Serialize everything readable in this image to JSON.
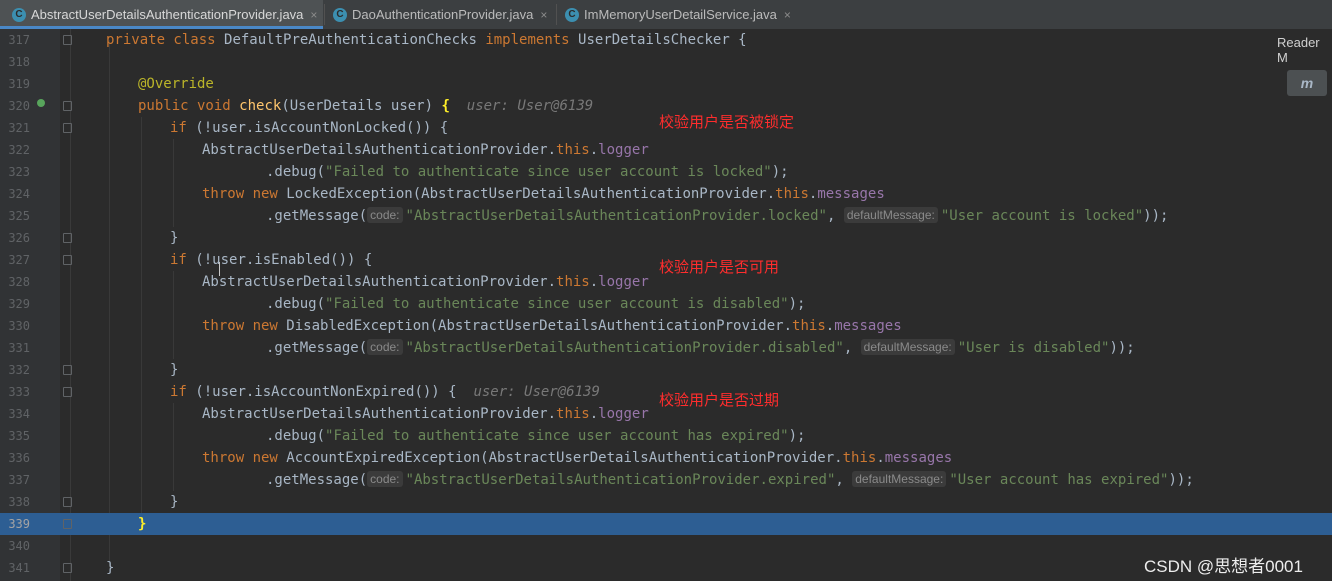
{
  "tabs": [
    {
      "label": "AbstractUserDetailsAuthenticationProvider.java",
      "icon": "java-class-icon"
    },
    {
      "label": "DaoAuthenticationProvider.java",
      "icon": "java-class-icon"
    },
    {
      "label": "ImMemoryUserDetailService.java",
      "icon": "java-class-icon"
    }
  ],
  "close_glyph": "×",
  "reader_mode_label": "Reader M",
  "maven_icon_label": "m",
  "notes": [
    "校验用户是否被锁定",
    "校验用户是否可用",
    "校验用户是否过期"
  ],
  "watermark": "CSDN @思想者0001",
  "code": {
    "l317_a": "private class ",
    "l317_b": "DefaultPreAuthenticationChecks ",
    "l317_c": "implements ",
    "l317_d": "UserDetailsChecker {",
    "l319": "@Override",
    "l320_a": "public void ",
    "l320_b": "check",
    "l320_c": "(UserDetails user) ",
    "l320_d": "{",
    "l320_hint": "user: User@6139",
    "l321_a": "if ",
    "l321_b": "(!user.isAccountNonLocked()) {",
    "l322_a": "AbstractUserDetailsAuthenticationProvider.",
    "l322_b": "this",
    "l322_c": ".",
    "l322_d": "logger",
    "l323_a": ".debug(",
    "l323_b": "\"Failed to authenticate since user account is locked\"",
    "l323_c": ");",
    "l324_a": "throw new ",
    "l324_b": "LockedException(AbstractUserDetailsAuthenticationProvider.",
    "l324_c": "this",
    "l324_d": ".",
    "l324_e": "messages",
    "l325_a": ".getMessage(",
    "l325_p1": "code:",
    "l325_b": "\"AbstractUserDetailsAuthenticationProvider.locked\"",
    "l325_c": ", ",
    "l325_p2": "defaultMessage:",
    "l325_d": "\"User account is locked\"",
    "l325_e": "));",
    "close_brace": "}",
    "l327_a": "if ",
    "l327_b": "(!user.isEnabled()) {",
    "l329_b": "\"Failed to authenticate since user account is disabled\"",
    "l330_b": "DisabledException(AbstractUserDetailsAuthenticationProvider.",
    "l331_b": "\"AbstractUserDetailsAuthenticationProvider.disabled\"",
    "l331_d": "\"User is disabled\"",
    "l333_b": "(!user.isAccountNonExpired()) {",
    "l333_hint": "user: User@6139",
    "l335_b": "\"Failed to authenticate since user account has expired\"",
    "l336_b": "AccountExpiredException(AbstractUserDetailsAuthenticationProvider.",
    "l337_b": "\"AbstractUserDetailsAuthenticationProvider.expired\"",
    "l337_d": "\"User account has expired\""
  },
  "line_numbers": [
    "317",
    "318",
    "319",
    "320",
    "321",
    "322",
    "323",
    "324",
    "325",
    "326",
    "327",
    "328",
    "329",
    "330",
    "331",
    "332",
    "333",
    "334",
    "335",
    "336",
    "337",
    "338",
    "339",
    "340",
    "341"
  ]
}
